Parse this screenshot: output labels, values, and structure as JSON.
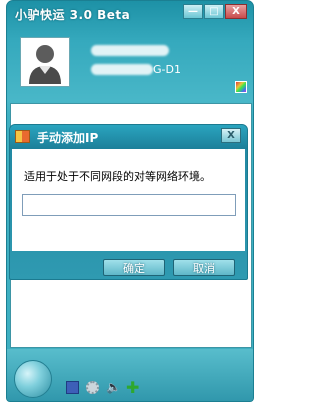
{
  "app": {
    "title": "小驴快运 3.0 Beta",
    "status_suffix": "G-D1",
    "window_buttons": {
      "minimize": "—",
      "restore": "□",
      "close": "X"
    }
  },
  "dialog": {
    "title": "手动添加IP",
    "close_label": "X",
    "description": "适用于处于不同网段的对等网络环境。",
    "input_value": "",
    "ok_label": "确定",
    "cancel_label": "取消"
  },
  "colors": {
    "window_teal": "#35a9bd",
    "dialog_teal": "#1f86a1",
    "button_teal": "#5fb7c8"
  },
  "icons": [
    "avatar",
    "color-palette-icon",
    "network-icon",
    "monitor-icon",
    "gear-icon",
    "speaker-icon",
    "plus-icon"
  ]
}
